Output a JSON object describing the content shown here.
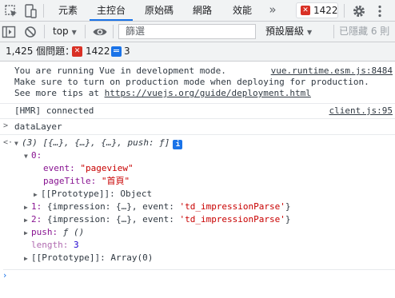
{
  "tabbar": {
    "tabs": [
      "元素",
      "主控台",
      "原始碼",
      "網路",
      "效能"
    ],
    "active_tab": "主控台",
    "more_label": "»",
    "error_count": "1422",
    "icons": [
      "cursor-inspect-icon",
      "device-toggle-icon",
      "error-icon",
      "gear-icon",
      "kebab-menu-icon"
    ]
  },
  "toolbar": {
    "context": "top",
    "filter_placeholder": "篩選",
    "levels": "預設層級",
    "hidden": "已隱藏 6 則",
    "icons": [
      "sidebar-toggle-icon",
      "clear-icon",
      "eye-icon"
    ]
  },
  "issues": {
    "count_label": "1,425 個問題：",
    "errors": "1422",
    "infos": "3"
  },
  "messages": {
    "vue_line1": "You are running Vue in development mode.",
    "vue_line2": "Make sure to turn on production mode when deploying for production.",
    "vue_line3_prefix": "See more tips at ",
    "vue_line3_link": "https://vuejs.org/guide/deployment.html",
    "vue_source": "vue.runtime.esm.js:8484",
    "hmr_text": "[HMR] connected",
    "hmr_source": "client.js:95",
    "input_expression": "dataLayer"
  },
  "result": {
    "summary": "(3) [{…}, {…}, {…}, push: ƒ]",
    "item0_key": "0:",
    "event_key": "event:",
    "event_value": "\"pageview\"",
    "pagetitle_key": "pageTitle:",
    "pagetitle_value": "\"首頁\"",
    "proto0": "[[Prototype]]: Object",
    "item1_key": "1:",
    "item1_value_prefix": "{impression: {…}, event: ",
    "item1_value_str": "'td_impressionParse'",
    "item1_value_suffix": "}",
    "item2_key": "2:",
    "item2_value_prefix": "{impression: {…}, event: ",
    "item2_value_str": "'td_impressionParse'",
    "item2_value_suffix": "}",
    "push_key": "push:",
    "push_value": "ƒ ()",
    "length_key": "length:",
    "length_value": "3",
    "proto_array": "[[Prototype]]: Array(0)"
  }
}
